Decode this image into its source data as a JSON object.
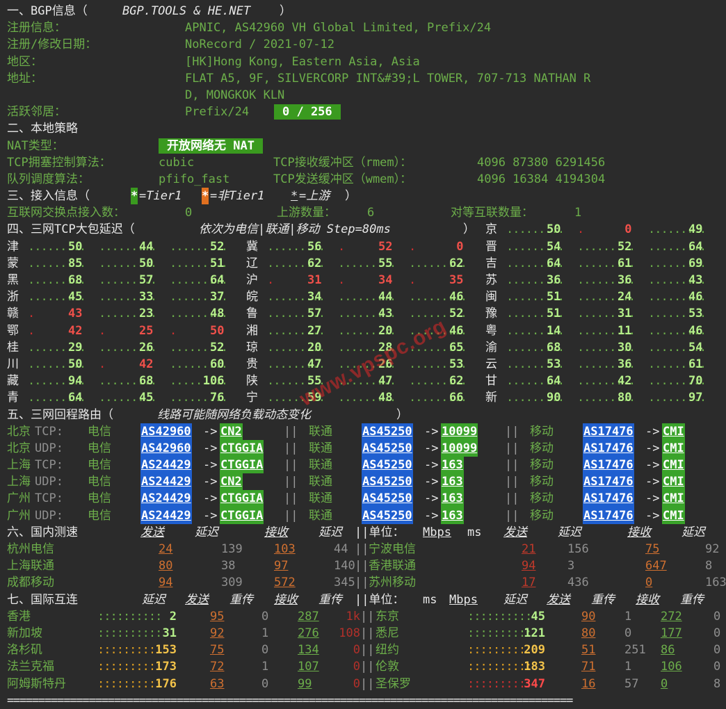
{
  "s1": {
    "title": "一、BGP信息（",
    "title_src": "BGP.TOOLS & HE.NET",
    "title_end": "）",
    "reg_label": "注册信息：",
    "reg_value": "APNIC, AS42960 VH Global Limited, Prefix/24",
    "date_label": "注册/修改日期：",
    "date_value": "NoRecord / 2021-07-12",
    "region_label": "地区：",
    "region_value": "[HK]Hong Kong, Eastern Asia, Asia",
    "addr_label": "地址：",
    "addr_value1": "FLAT A5, 9F, SILVERCORP INT&#39;L TOWER, 707-713 NATHAN R",
    "addr_value2": "D, MONGKOK KLN",
    "active_label": "活跃邻居：",
    "active_prefix": "Prefix/24",
    "active_badge": "0 / 256"
  },
  "s2": {
    "title": "二、本地策略",
    "nat_label": "NAT类型：",
    "nat_badge": "开放网络无 NAT",
    "cc_label": "TCP拥塞控制算法：",
    "cc_value": "cubic",
    "rmem_label": "TCP接收缓冲区（rmem）：",
    "rmem_value": "4096 87380 6291456",
    "qd_label": "队列调度算法：",
    "qd_value": "pfifo_fast",
    "wmem_label": "TCP发送缓冲区（wmem）：",
    "wmem_value": "4096 16384 4194304"
  },
  "s3": {
    "title": "三、接入信息（",
    "star": "*",
    "t1": "=Tier1 ",
    "nont1": "=非Tier1 ",
    "up": "=上游",
    "end": "）",
    "ix_label": "互联网交换点接入数：",
    "ix_value": "0",
    "up_label": "上游数量：",
    "up_value": "6",
    "peer_label": "对等互联数量：",
    "peer_value": "1"
  },
  "s4": {
    "title": "四、三网TCP大包延迟（",
    "title_it": "依次为电信|联通|移动 Step=80ms",
    "title_end": "）",
    "left": [
      {
        "p": "津",
        "v": [
          "50",
          "44",
          "52"
        ],
        "c": [
          "g",
          "g",
          "g"
        ]
      },
      {
        "p": "蒙",
        "v": [
          "85",
          "50",
          "51"
        ],
        "c": [
          "g",
          "g",
          "g"
        ]
      },
      {
        "p": "黑",
        "v": [
          "68",
          "57",
          "64"
        ],
        "c": [
          "g",
          "g",
          "g"
        ]
      },
      {
        "p": "浙",
        "v": [
          "45",
          "33",
          "37"
        ],
        "c": [
          "g",
          "g",
          "g"
        ]
      },
      {
        "p": "赣",
        "v": [
          "43",
          "23",
          "48"
        ],
        "c": [
          "r",
          "g",
          "g"
        ]
      },
      {
        "p": "鄂",
        "v": [
          "42",
          "25",
          "50"
        ],
        "c": [
          "r",
          "r",
          "r"
        ]
      },
      {
        "p": "桂",
        "v": [
          "29",
          "26",
          "52"
        ],
        "c": [
          "g",
          "g",
          "g"
        ]
      },
      {
        "p": "川",
        "v": [
          "50",
          "42",
          "60"
        ],
        "c": [
          "g",
          "r",
          "g"
        ]
      },
      {
        "p": "藏",
        "v": [
          "94",
          "68",
          "106"
        ],
        "c": [
          "g",
          "g",
          "g"
        ]
      },
      {
        "p": "青",
        "v": [
          "64",
          "45",
          "76"
        ],
        "c": [
          "g",
          "g",
          "g"
        ]
      }
    ],
    "mid": [
      {
        "p": "冀",
        "v": [
          "56",
          "52",
          "0"
        ],
        "c": [
          "g",
          "r",
          "r"
        ]
      },
      {
        "p": "辽",
        "v": [
          "62",
          "55",
          "62"
        ],
        "c": [
          "g",
          "g",
          "g"
        ]
      },
      {
        "p": "沪",
        "v": [
          "31",
          "34",
          "35"
        ],
        "c": [
          "r",
          "r",
          "r"
        ]
      },
      {
        "p": "皖",
        "v": [
          "34",
          "44",
          "46"
        ],
        "c": [
          "g",
          "g",
          "g"
        ]
      },
      {
        "p": "鲁",
        "v": [
          "57",
          "43",
          "52"
        ],
        "c": [
          "g",
          "g",
          "g"
        ]
      },
      {
        "p": "湘",
        "v": [
          "27",
          "20",
          "46"
        ],
        "c": [
          "g",
          "g",
          "g"
        ]
      },
      {
        "p": "琼",
        "v": [
          "20",
          "28",
          "65"
        ],
        "c": [
          "g",
          "g",
          "g"
        ]
      },
      {
        "p": "贵",
        "v": [
          "47",
          "26",
          "53"
        ],
        "c": [
          "g",
          "g",
          "g"
        ]
      },
      {
        "p": "陕",
        "v": [
          "55",
          "47",
          "62"
        ],
        "c": [
          "g",
          "g",
          "g"
        ]
      },
      {
        "p": "宁",
        "v": [
          "59",
          "48",
          "66"
        ],
        "c": [
          "g",
          "g",
          "g"
        ]
      }
    ],
    "right": [
      {
        "p": "京",
        "v": [
          "50",
          "0",
          "49"
        ],
        "c": [
          "g",
          "r",
          "g"
        ]
      },
      {
        "p": "晋",
        "v": [
          "54",
          "52",
          "64"
        ],
        "c": [
          "g",
          "g",
          "g"
        ]
      },
      {
        "p": "吉",
        "v": [
          "64",
          "61",
          "69"
        ],
        "c": [
          "g",
          "g",
          "g"
        ]
      },
      {
        "p": "苏",
        "v": [
          "36",
          "36",
          "43"
        ],
        "c": [
          "g",
          "g",
          "g"
        ]
      },
      {
        "p": "闽",
        "v": [
          "51",
          "24",
          "46"
        ],
        "c": [
          "g",
          "g",
          "g"
        ]
      },
      {
        "p": "豫",
        "v": [
          "51",
          "31",
          "53"
        ],
        "c": [
          "g",
          "g",
          "g"
        ]
      },
      {
        "p": "粤",
        "v": [
          "14",
          "11",
          "46"
        ],
        "c": [
          "g",
          "g",
          "g"
        ]
      },
      {
        "p": "渝",
        "v": [
          "68",
          "30",
          "54"
        ],
        "c": [
          "g",
          "g",
          "g"
        ]
      },
      {
        "p": "云",
        "v": [
          "53",
          "36",
          "61"
        ],
        "c": [
          "g",
          "g",
          "g"
        ]
      },
      {
        "p": "甘",
        "v": [
          "64",
          "42",
          "70"
        ],
        "c": [
          "g",
          "g",
          "g"
        ]
      },
      {
        "p": "新",
        "v": [
          "90",
          "80",
          "97"
        ],
        "c": [
          "g",
          "g",
          "g"
        ]
      }
    ]
  },
  "s5": {
    "title": "五、三网回程路由（",
    "title_it": "线路可能随网络负载动态变化",
    "title_end": "）",
    "rows": [
      {
        "city": "北京",
        "proto": "TCP:",
        "ct_as": "AS42960",
        "ct_n": "CN2",
        "cu_as": "AS45250",
        "cu_n": "10099",
        "cm_as": "AS17476",
        "cm_n": "CMI"
      },
      {
        "city": "北京",
        "proto": "UDP:",
        "ct_as": "AS42960",
        "ct_n": "CTGGIA",
        "cu_as": "AS45250",
        "cu_n": "10099",
        "cm_as": "AS17476",
        "cm_n": "CMI"
      },
      {
        "city": "上海",
        "proto": "TCP:",
        "ct_as": "AS24429",
        "ct_n": "CTGGIA",
        "cu_as": "AS45250",
        "cu_n": "163",
        "cm_as": "AS17476",
        "cm_n": "CMI"
      },
      {
        "city": "上海",
        "proto": "UDP:",
        "ct_as": "AS24429",
        "ct_n": "CN2",
        "cu_as": "AS45250",
        "cu_n": "163",
        "cm_as": "AS17476",
        "cm_n": "CMI"
      },
      {
        "city": "广州",
        "proto": "TCP:",
        "ct_as": "AS24429",
        "ct_n": "CTGGIA",
        "cu_as": "AS45250",
        "cu_n": "163",
        "cm_as": "AS17476",
        "cm_n": "CMI"
      },
      {
        "city": "广州",
        "proto": "UDP:",
        "ct_as": "AS24429",
        "ct_n": "CTGGIA",
        "cu_as": "AS45250",
        "cu_n": "163",
        "cm_as": "AS17476",
        "cm_n": "CMI"
      }
    ],
    "ct": "电信",
    "cu": "联通",
    "cm": "移动",
    "arrow": "->",
    "bar": "||"
  },
  "s6": {
    "title": "六、国内测速",
    "h_send": "发送",
    "h_lat": "延迟",
    "h_recv": "接收",
    "h_lat2": "延迟",
    "unit_label": "||单位：",
    "unit_mbps": "Mbps",
    "unit_ms": "ms",
    "rows": [
      {
        "l": "杭州电信",
        "s": "24",
        "sl": "139",
        "r": "103",
        "rl": "44",
        "rn": "宁波电信",
        "s2": "21",
        "sl2": "156",
        "r2": "75",
        "rl2": "92"
      },
      {
        "l": "上海联通",
        "s": "80",
        "sl": "38",
        "r": "97",
        "rl": "140",
        "rn": "香港联通",
        "s2": "94",
        "sl2": "3",
        "r2": "647",
        "rl2": "8"
      },
      {
        "l": "成都移动",
        "s": "94",
        "sl": "309",
        "r": "572",
        "rl": "345",
        "rn": "苏州移动",
        "s2": "17",
        "sl2": "436",
        "r2": "0",
        "rl2": "163"
      }
    ]
  },
  "s7": {
    "title": "七、国际互连",
    "h_lat": "延迟",
    "h_send": "发送",
    "h_rt": "重传",
    "h_recv": "接收",
    "h_rt2": "重传",
    "unit_label": "||单位：",
    "unit_ms": "ms",
    "unit_mbps": "Mbps",
    "rows": [
      {
        "l": "香港",
        "lat": "2",
        "s": "95",
        "st": "0",
        "r": "287",
        "rt": "1k",
        "rn": "东京",
        "lat2": "45",
        "s2": "90",
        "st2": "1",
        "r2": "272",
        "rt2": "0"
      },
      {
        "l": "新加坡",
        "lat": "31",
        "s": "92",
        "st": "1",
        "r": "276",
        "rt": "108",
        "rn": "悉尼",
        "lat2": "121",
        "s2": "80",
        "st2": "0",
        "r2": "177",
        "rt2": "0"
      },
      {
        "l": "洛杉矶",
        "lat": "153",
        "s": "75",
        "st": "0",
        "r": "134",
        "rt": "0",
        "rn": "纽约",
        "lat2": "209",
        "s2": "51",
        "st2": "251",
        "r2": "86",
        "rt2": "0"
      },
      {
        "l": "法兰克福",
        "lat": "173",
        "s": "72",
        "st": "1",
        "r": "107",
        "rt": "0",
        "rn": "伦敦",
        "lat2": "183",
        "s2": "71",
        "st2": "1",
        "r2": "106",
        "rt2": "0"
      },
      {
        "l": "阿姆斯特丹",
        "lat": "176",
        "s": "63",
        "st": "0",
        "r": "99",
        "rt": "0",
        "rn": "圣保罗",
        "lat2": "347",
        "s2": "16",
        "st2": "57",
        "r2": "0",
        "rt2": "8"
      }
    ]
  },
  "footer": "==========================================================================================",
  "watermark": "www.vpspc.org"
}
